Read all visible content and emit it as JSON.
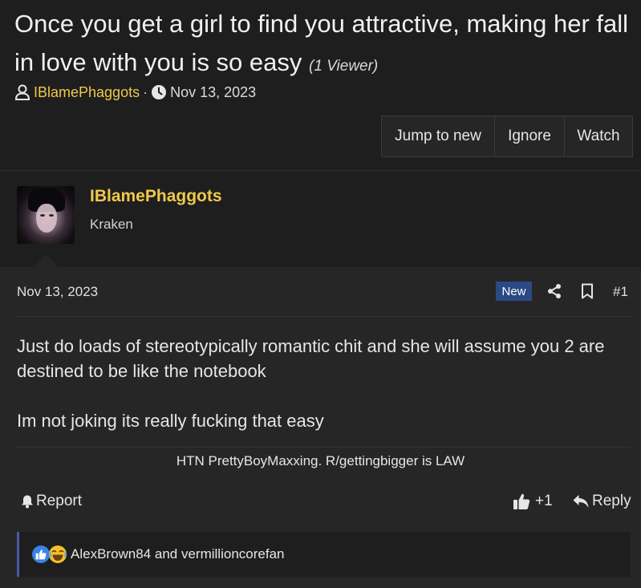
{
  "thread": {
    "title": "Once you get a girl to find you attractive, making her fall in love with you is so easy",
    "viewers": "(1 Viewer)",
    "author": "IBlamePhaggots",
    "separator": "·",
    "date": "Nov 13, 2023"
  },
  "buttons": {
    "jump_to_new": "Jump to new",
    "ignore": "Ignore",
    "watch": "Watch"
  },
  "post": {
    "username": "IBlamePhaggots",
    "user_title": "Kraken",
    "date": "Nov 13, 2023",
    "badge": "New",
    "number": "#1",
    "body": [
      "Just do loads of stereotypically romantic chit and she will assume you 2 are destined to be like the notebook",
      "",
      "Im not joking its really fucking that easy"
    ],
    "signature": "HTN PrettyBoyMaxxing. R/gettingbigger is LAW",
    "actions": {
      "report": "Report",
      "like": "+1",
      "reply": "Reply"
    },
    "reactions": {
      "names": "AlexBrown84 and vermillioncorefan",
      "icons": [
        "like-icon",
        "laugh-icon"
      ]
    }
  },
  "colors": {
    "background": "#1e1e1e",
    "post_background": "#262626",
    "author": "#f0c84a",
    "badge": "#2a4a85",
    "reaction_bar": "#4a5aa6"
  }
}
